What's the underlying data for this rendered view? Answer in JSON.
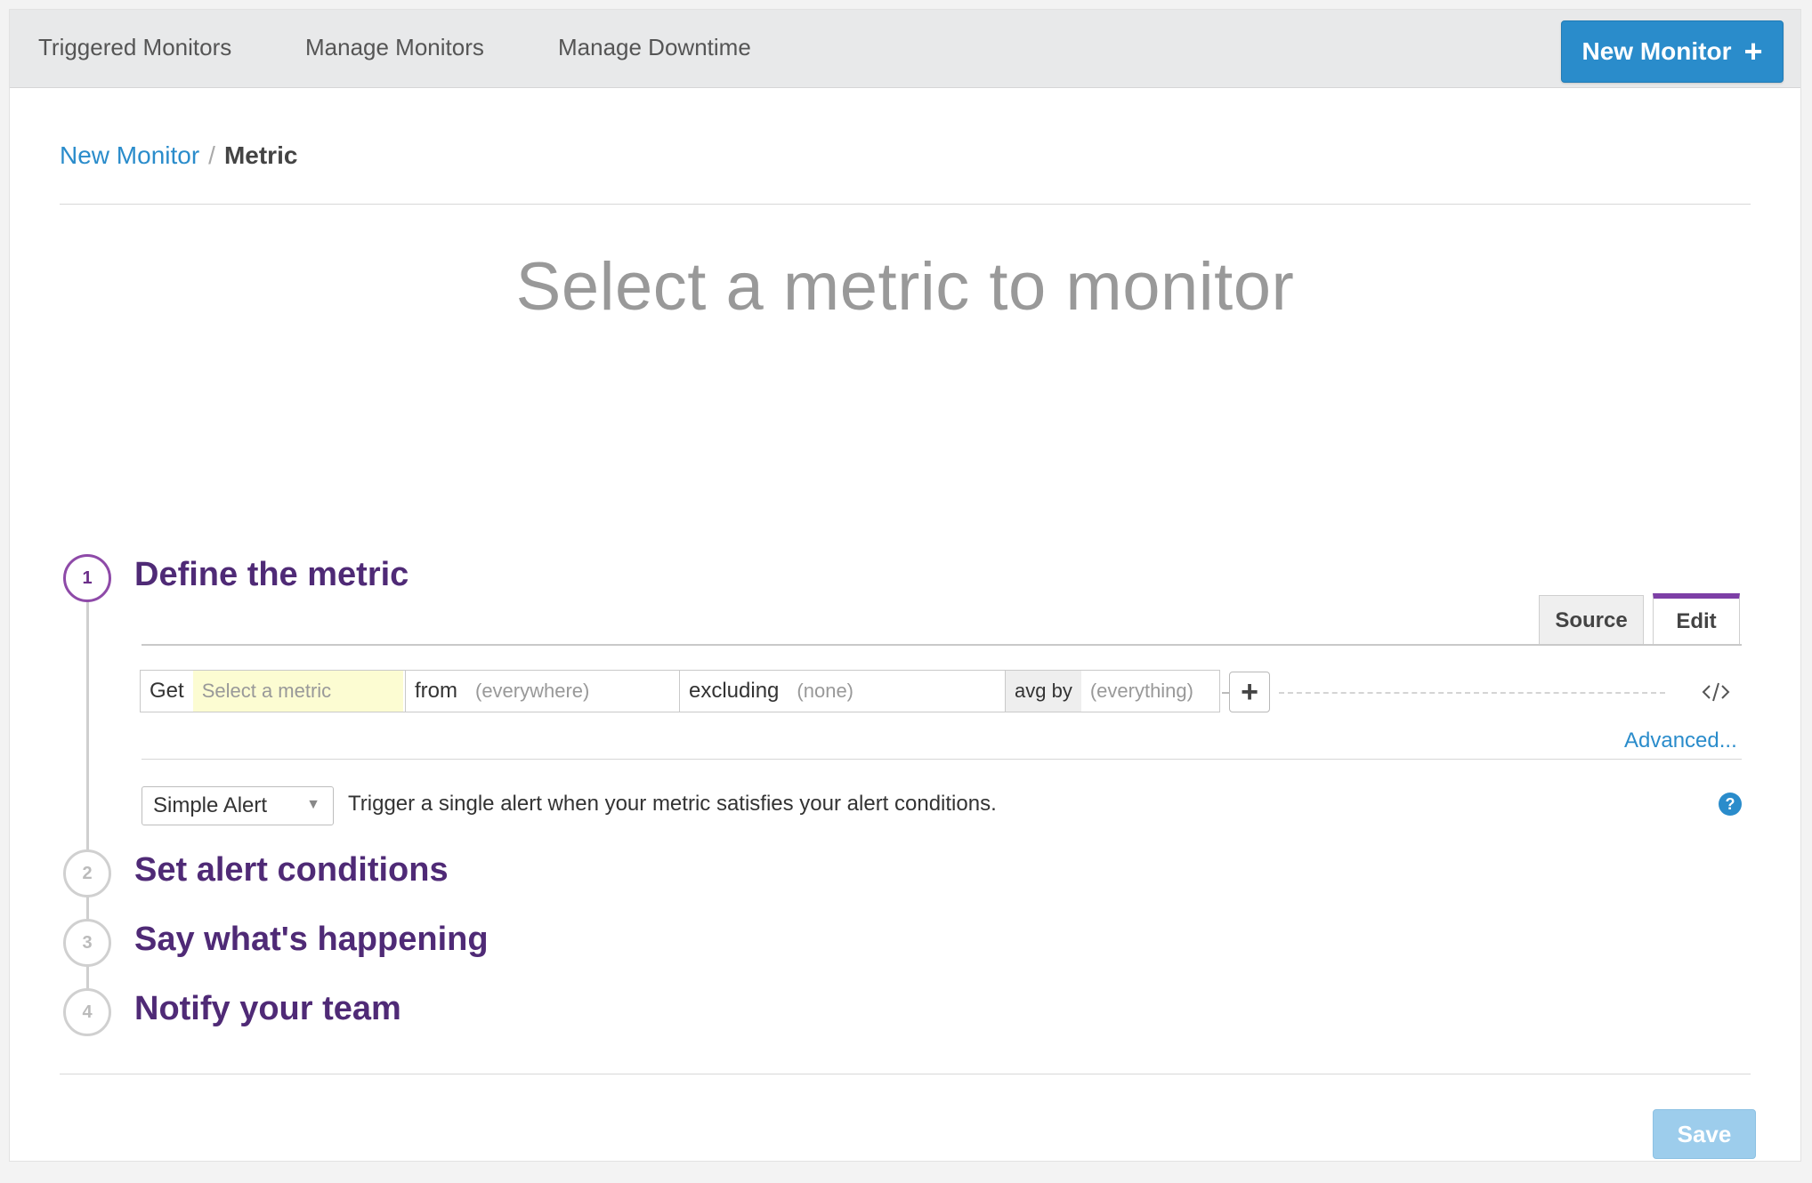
{
  "nav": {
    "items": [
      {
        "label": "Triggered Monitors"
      },
      {
        "label": "Manage Monitors"
      },
      {
        "label": "Manage Downtime"
      }
    ],
    "new_monitor_label": "New Monitor",
    "plus_icon": "+"
  },
  "breadcrumb": {
    "parent": "New Monitor",
    "separator": "/",
    "current": "Metric"
  },
  "page_title": "Select a metric to monitor",
  "steps": [
    {
      "number": "1",
      "title": "Define the metric",
      "active": true
    },
    {
      "number": "2",
      "title": "Set alert conditions",
      "active": false
    },
    {
      "number": "3",
      "title": "Say what's happening",
      "active": false
    },
    {
      "number": "4",
      "title": "Notify your team",
      "active": false
    }
  ],
  "editor_tabs": {
    "source_label": "Source",
    "edit_label": "Edit",
    "active": "Edit"
  },
  "query": {
    "get_label": "Get",
    "metric_placeholder": "Select a metric",
    "from_label": "from",
    "from_value": "(everywhere)",
    "excluding_label": "excluding",
    "excluding_value": "(none)",
    "avg_by_label": "avg by",
    "avg_by_value": "(everything)",
    "add_icon": "+"
  },
  "advanced_link": "Advanced...",
  "alert_type": {
    "selected": "Simple Alert",
    "description": "Trigger a single alert when your metric satisfies your alert conditions.",
    "help_icon": "?"
  },
  "save_label": "Save",
  "colors": {
    "primary_blue": "#2a8ccb",
    "step_purple": "#4f2a76",
    "active_tab_accent": "#7d3fa6",
    "metric_highlight": "#fcfcd2"
  }
}
